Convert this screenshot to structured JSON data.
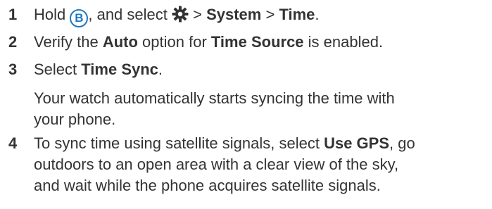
{
  "steps": [
    {
      "number": "1",
      "parts": {
        "p1": "Hold ",
        "button_letter": "B",
        "p2": ", and select ",
        "p3": " > ",
        "system": "System",
        "p4": " > ",
        "time": "Time",
        "p5": "."
      },
      "icons": [
        "b-button-icon",
        "gear-icon"
      ]
    },
    {
      "number": "2",
      "parts": {
        "p1": "Verify the ",
        "auto": "Auto",
        "p2": " option for ",
        "time_source": "Time Source",
        "p3": " is enabled."
      }
    },
    {
      "number": "3",
      "parts": {
        "p1": "Select ",
        "time_sync": "Time Sync",
        "p2": "."
      },
      "note_lines": [
        "Your watch automatically starts syncing the time with",
        "your phone."
      ]
    },
    {
      "number": "4",
      "parts": {
        "p1": "To sync time using satellite signals, select ",
        "use_gps": "Use GPS",
        "p2": ", go",
        "line2": "outdoors to an open area with a clear view of the sky,",
        "line3": "and wait while the phone acquires satellite signals."
      }
    }
  ],
  "colors": {
    "text": "#333333",
    "accent": "#1f77c4"
  }
}
